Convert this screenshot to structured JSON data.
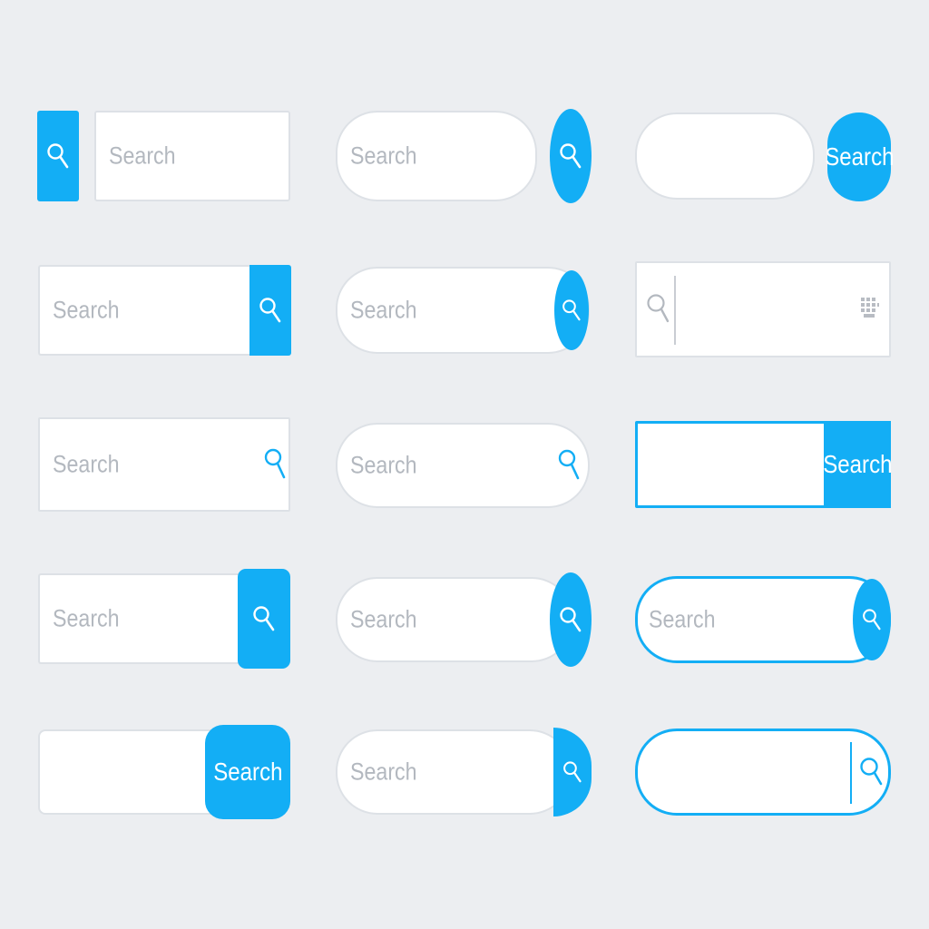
{
  "search": {
    "placeholder": "Search",
    "button_label": "Search"
  },
  "colors": {
    "background": "#eceef1",
    "accent": "#13aef5",
    "field": "#ffffff",
    "border": "#dde1e6",
    "placeholder": "#b3b8bf"
  },
  "icons": {
    "search": "magnifier-icon",
    "keyboard": "keyboard-icon"
  }
}
